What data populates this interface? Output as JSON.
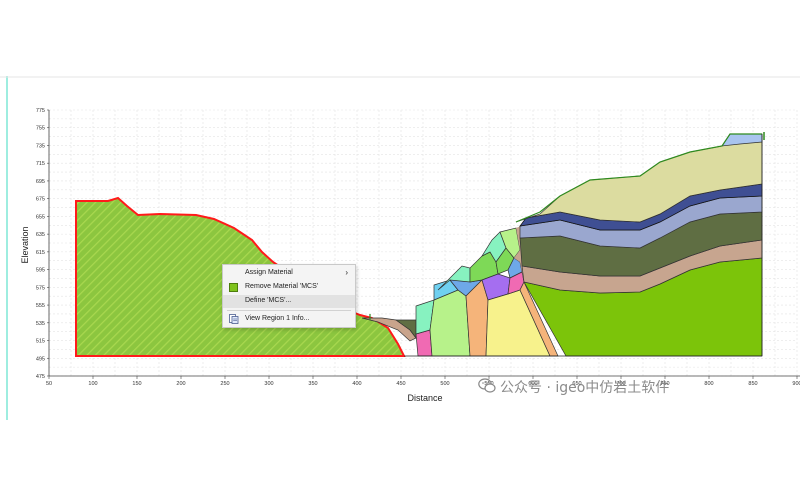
{
  "chart_data": {
    "type": "area",
    "xlabel": "Distance",
    "ylabel": "Elevation",
    "x_ticks": [
      "50",
      "100",
      "150",
      "200",
      "250",
      "300",
      "350",
      "400",
      "450",
      "500",
      "550",
      "600",
      "650",
      "700",
      "750",
      "800",
      "850",
      "900"
    ],
    "y_ticks": [
      "475",
      "495",
      "515",
      "535",
      "555",
      "575",
      "595",
      "615",
      "635",
      "655",
      "675",
      "695",
      "715",
      "735",
      "755",
      "775"
    ],
    "xlim": [
      50,
      900
    ],
    "ylim": [
      475,
      775
    ],
    "grid": true,
    "selected_region": "Region 1",
    "selected_material": "MCS"
  },
  "context_menu": {
    "assign_material": "Assign Material",
    "remove_material": "Remove Material 'MCS'",
    "define": "Define 'MCS'...",
    "view_info": "View Region 1 Info..."
  },
  "watermark": {
    "text": "公众号 · igeo中仿岩土软件"
  },
  "colors": {
    "selected_fill": "#8cc63f",
    "selected_outline": "#ff1a1a",
    "grid": "#dddddd",
    "accent_line": "#7fe7d6"
  }
}
